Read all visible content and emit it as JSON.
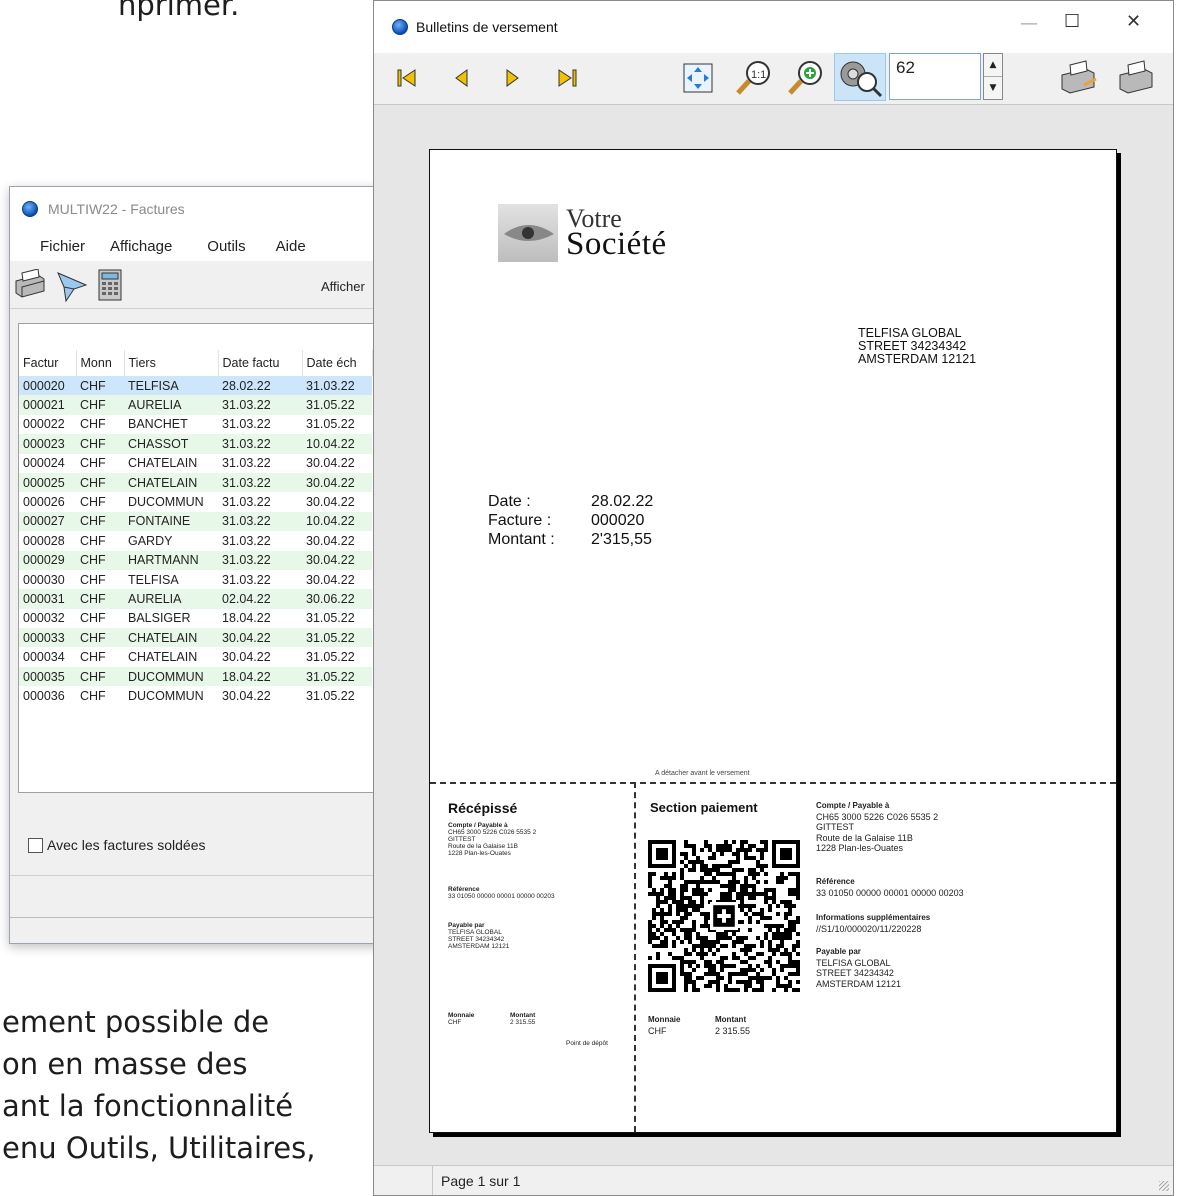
{
  "background": {
    "top_fragment": "nprimer.",
    "bottom_lines": [
      "ement possible de",
      "on en masse des",
      "ant la fonctionnalité",
      "enu Outils, Utilitaires,"
    ]
  },
  "factures_window": {
    "title": "MULTIW22 - Factures",
    "menu": [
      "Fichier",
      "Affichage",
      "Outils",
      "Aide"
    ],
    "afficher_label": "Afficher",
    "columns": [
      "Factur",
      "Monn",
      "Tiers",
      "Date factu",
      "Date éch"
    ],
    "rows": [
      [
        "000020",
        "CHF",
        "TELFISA",
        "28.02.22",
        "31.03.22"
      ],
      [
        "000021",
        "CHF",
        "AURELIA",
        "31.03.22",
        "31.05.22"
      ],
      [
        "000022",
        "CHF",
        "BANCHET",
        "31.03.22",
        "31.05.22"
      ],
      [
        "000023",
        "CHF",
        "CHASSOT",
        "31.03.22",
        "10.04.22"
      ],
      [
        "000024",
        "CHF",
        "CHATELAIN",
        "31.03.22",
        "30.04.22"
      ],
      [
        "000025",
        "CHF",
        "CHATELAIN",
        "31.03.22",
        "30.04.22"
      ],
      [
        "000026",
        "CHF",
        "DUCOMMUN",
        "31.03.22",
        "30.04.22"
      ],
      [
        "000027",
        "CHF",
        "FONTAINE",
        "31.03.22",
        "10.04.22"
      ],
      [
        "000028",
        "CHF",
        "GARDY",
        "31.03.22",
        "30.04.22"
      ],
      [
        "000029",
        "CHF",
        "HARTMANN",
        "31.03.22",
        "30.04.22"
      ],
      [
        "000030",
        "CHF",
        "TELFISA",
        "31.03.22",
        "30.04.22"
      ],
      [
        "000031",
        "CHF",
        "AURELIA",
        "02.04.22",
        "30.06.22"
      ],
      [
        "000032",
        "CHF",
        "BALSIGER",
        "18.04.22",
        "31.05.22"
      ],
      [
        "000033",
        "CHF",
        "CHATELAIN",
        "30.04.22",
        "31.05.22"
      ],
      [
        "000034",
        "CHF",
        "CHATELAIN",
        "30.04.22",
        "31.05.22"
      ],
      [
        "000035",
        "CHF",
        "DUCOMMUN",
        "18.04.22",
        "31.05.22"
      ],
      [
        "000036",
        "CHF",
        "DUCOMMUN",
        "30.04.22",
        "31.05.22"
      ]
    ],
    "checkbox_label": "Avec les factures soldées"
  },
  "bulletins_window": {
    "title": "Bulletins de versement",
    "win_minimize": "—",
    "win_maximize": "☐",
    "win_close": "✕",
    "zoom_value": "62",
    "status_page": "Page 1 sur 1",
    "document": {
      "logo_line1": "Votre",
      "logo_line2": "Société",
      "recipient": [
        "TELFISA GLOBAL",
        "STREET 34234342",
        "AMSTERDAM 12121"
      ],
      "info_labels": [
        "Date :",
        "Facture :",
        "Montant :"
      ],
      "info_values": [
        "28.02.22",
        "000020",
        "2'315,55"
      ],
      "detach_note": "A détacher avant le versement",
      "receipt": {
        "title": "Récépissé",
        "account_label": "Compte / Payable à",
        "account_lines": [
          "CH65 3000 5226 C026 5535 2",
          "GITTEST",
          "Route de la Galaise 11B",
          "1228 Plan-les-Ouates"
        ],
        "reference_label": "Référence",
        "reference": "33 01050 00000 00001 00000 00203",
        "payer_label": "Payable par",
        "payer_lines": [
          "TELFISA GLOBAL",
          "STREET 34234342",
          "AMSTERDAM 12121"
        ],
        "currency_label": "Monnaie",
        "currency": "CHF",
        "amount_label": "Montant",
        "amount": "2 315.55",
        "depot_label": "Point de dépôt"
      },
      "payment": {
        "title": "Section paiement",
        "account_label": "Compte / Payable à",
        "account_lines": [
          "CH65 3000 5226 C026 5535 2",
          "GITTEST",
          "Route de la Galaise 11B",
          "1228 Plan-les-Ouates"
        ],
        "reference_label": "Référence",
        "reference": "33 01050 00000 00001 00000 00203",
        "extra_label": "Informations supplémentaires",
        "extra": "//S1/10/000020/11/220228",
        "payer_label": "Payable par",
        "payer_lines": [
          "TELFISA GLOBAL",
          "STREET 34234342",
          "AMSTERDAM 12121"
        ],
        "currency_label": "Monnaie",
        "currency": "CHF",
        "amount_label": "Montant",
        "amount": "2 315.55"
      }
    }
  },
  "colors": {
    "row_alt": "#e8f8e8",
    "row_selected": "#cde6fb",
    "nav_yellow": "#f2c200"
  }
}
